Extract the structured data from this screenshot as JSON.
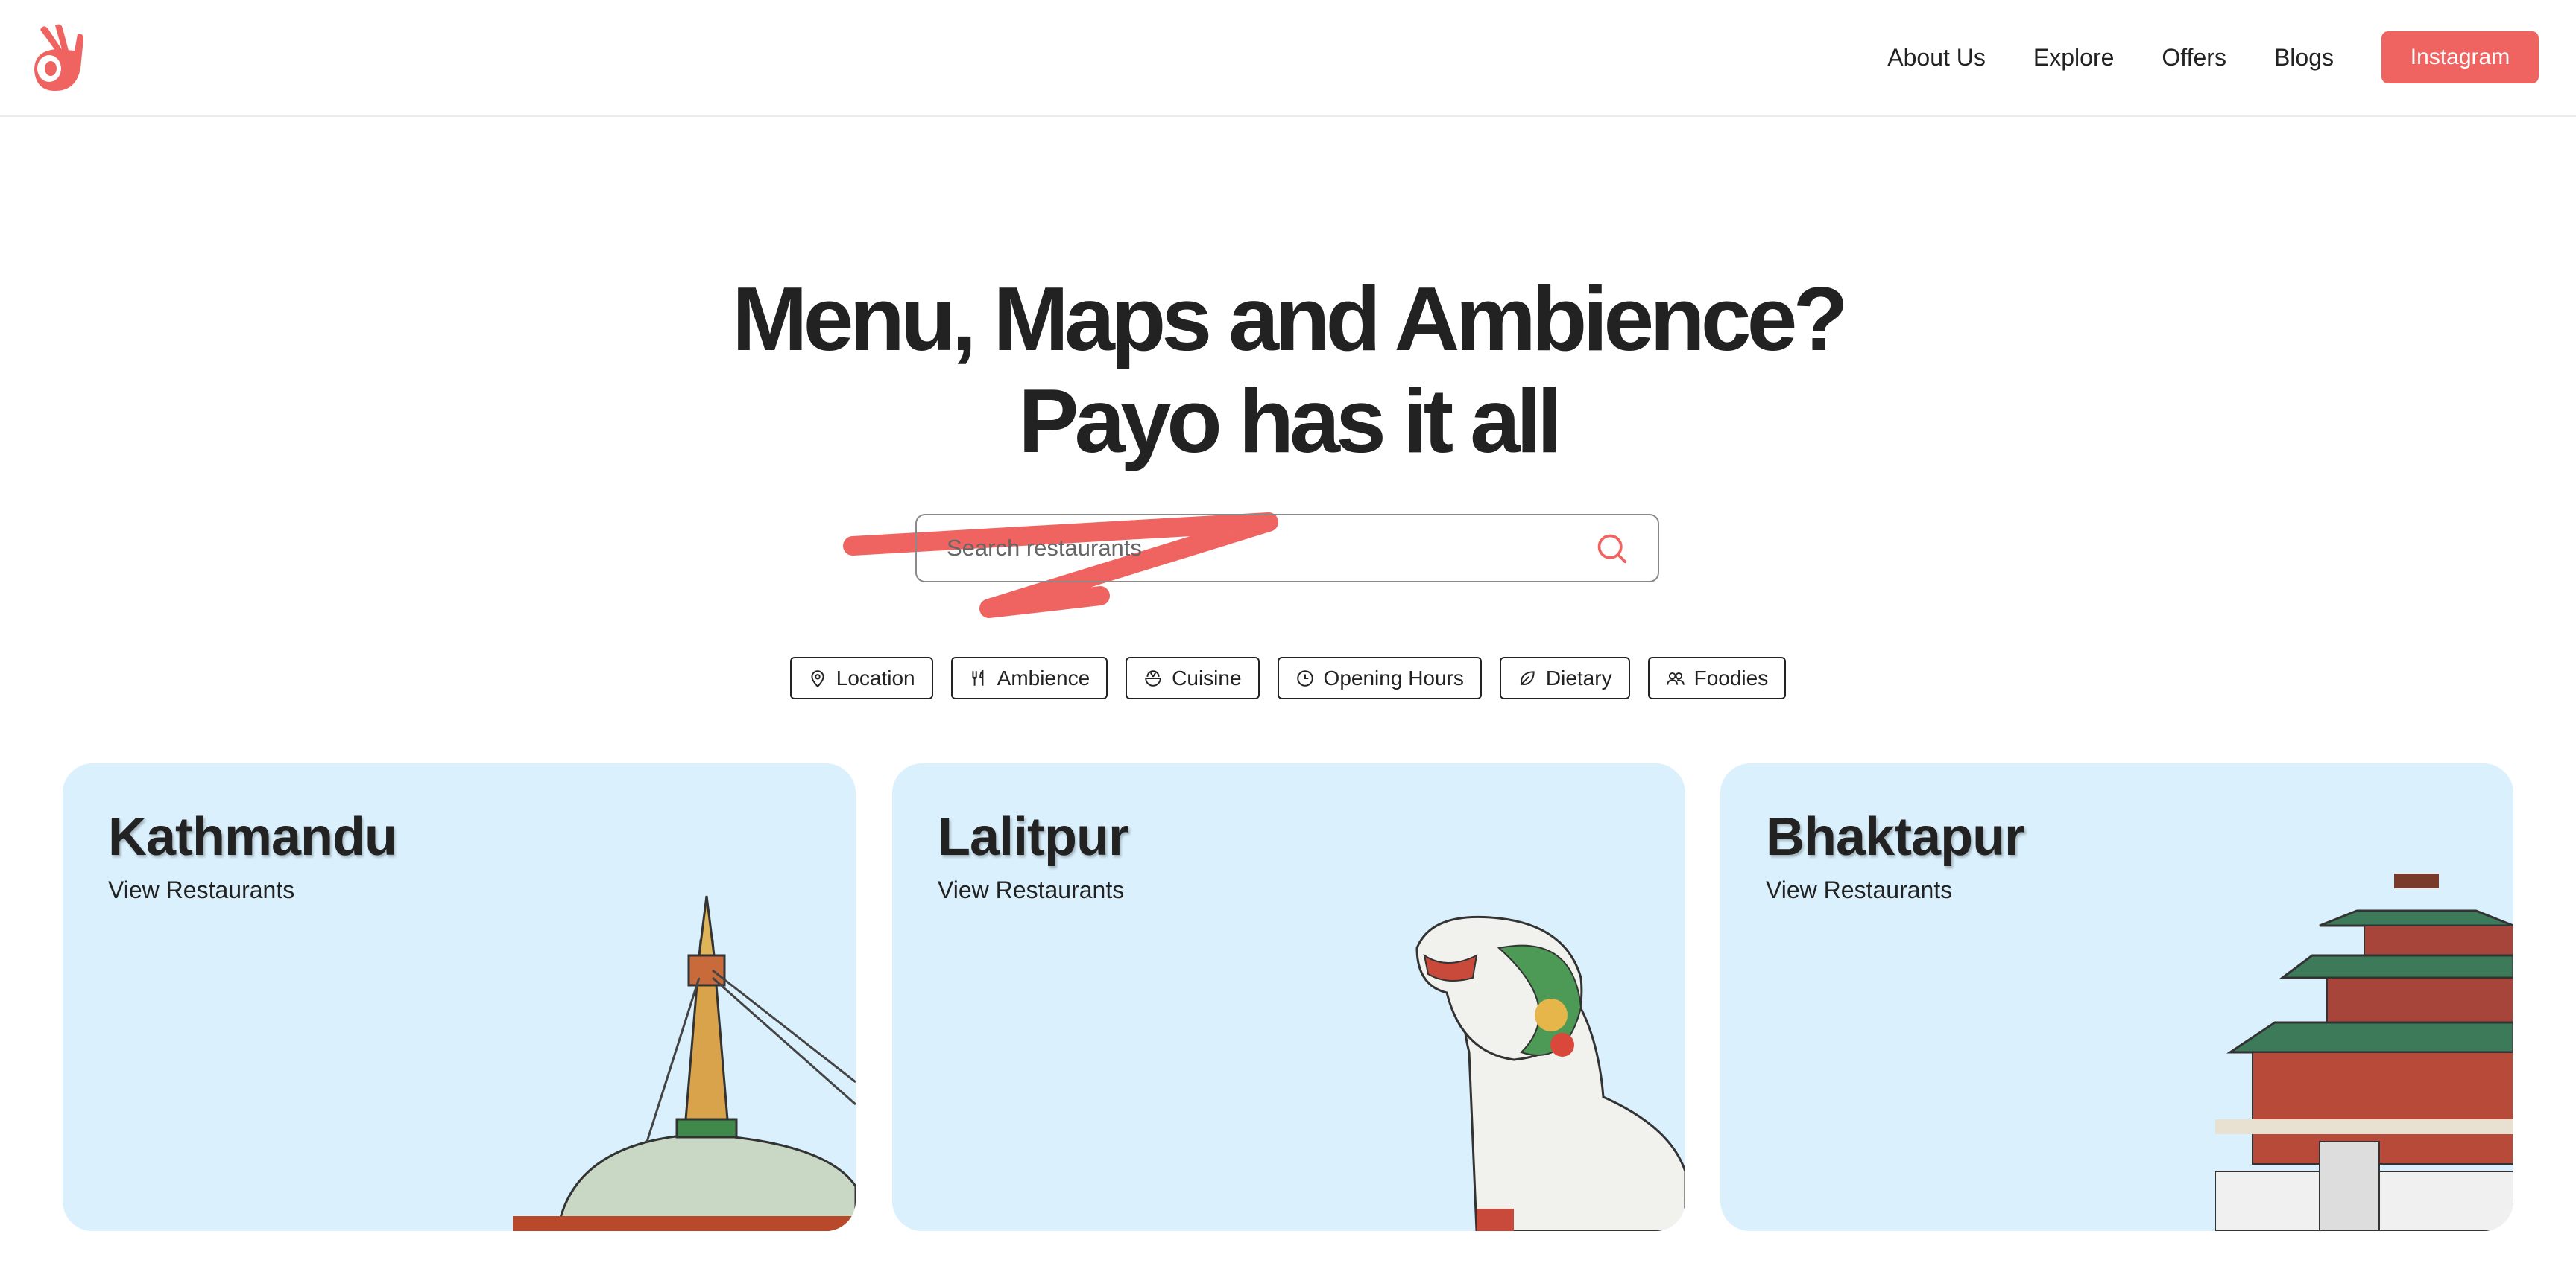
{
  "nav": {
    "logo": "payo-hand-logo",
    "links": [
      "About Us",
      "Explore",
      "Offers",
      "Blogs"
    ],
    "cta": "Instagram",
    "accent": "#ef6461"
  },
  "hero": {
    "line1": "Menu, Maps and Ambience?",
    "line2": "Payo has it all"
  },
  "search": {
    "placeholder": "Search restaurants",
    "value": "",
    "icon": "search-icon"
  },
  "filters": [
    {
      "label": "Location",
      "icon": "map-pin-icon"
    },
    {
      "label": "Ambience",
      "icon": "utensils-icon"
    },
    {
      "label": "Cuisine",
      "icon": "bowl-icon"
    },
    {
      "label": "Opening Hours",
      "icon": "clock-icon"
    },
    {
      "label": "Dietary",
      "icon": "leaf-icon"
    },
    {
      "label": "Foodies",
      "icon": "users-icon"
    }
  ],
  "cards": [
    {
      "title": "Kathmandu",
      "subtitle": "View Restaurants",
      "image": "stupa-illustration"
    },
    {
      "title": "Lalitpur",
      "subtitle": "View Restaurants",
      "image": "lion-statue-illustration"
    },
    {
      "title": "Bhaktapur",
      "subtitle": "View Restaurants",
      "image": "pagoda-temple-illustration"
    }
  ],
  "card_color": "#daf0fc"
}
